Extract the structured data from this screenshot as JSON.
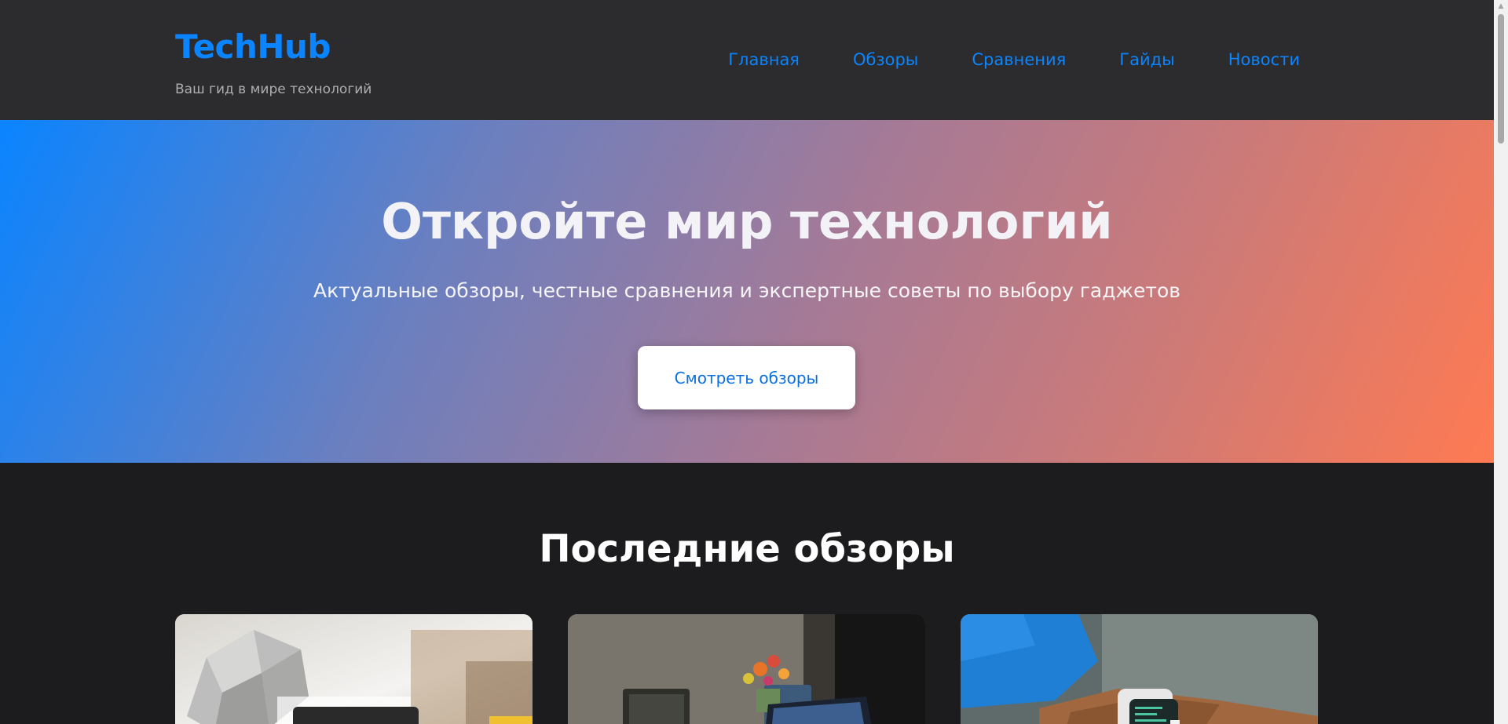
{
  "header": {
    "brand": "TechHub",
    "tagline": "Ваш гид в мире технологий",
    "nav": [
      "Главная",
      "Обзоры",
      "Сравнения",
      "Гайды",
      "Новости"
    ]
  },
  "hero": {
    "title": "Откройте мир технологий",
    "subtitle": "Актуальные обзоры, честные сравнения и экспертные советы по выбору гаджетов",
    "button_label": "Смотреть обзоры"
  },
  "reviews": {
    "title": "Последние обзоры",
    "cards": [
      {
        "image": "desk-gadgets-photo"
      },
      {
        "image": "laptop-workspace-photo"
      },
      {
        "image": "smartwatch-photo"
      }
    ]
  },
  "colors": {
    "accent": "#0a84ff",
    "header_bg": "#2c2c2e",
    "page_bg": "#1c1c1e",
    "hero_gradient_start": "#0a84ff",
    "hero_gradient_end": "#ff7a52"
  }
}
